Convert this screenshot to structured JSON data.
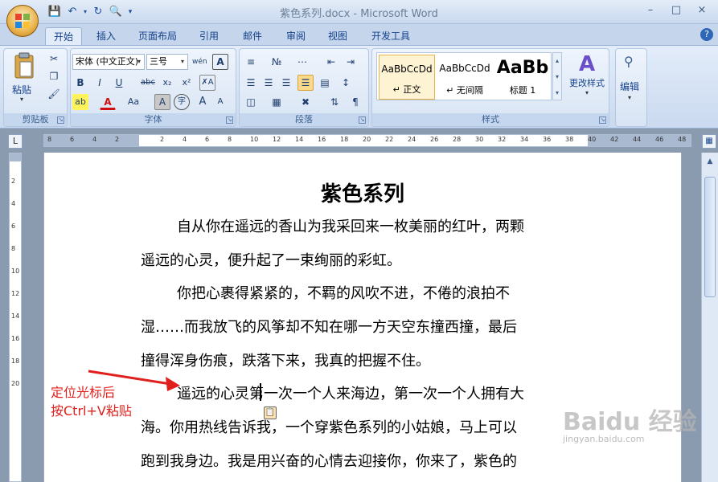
{
  "window": {
    "title": "紫色系列.docx - Microsoft Word",
    "controls": [
      "–",
      "□",
      "×"
    ],
    "help_icon": "?"
  },
  "quick_access": [
    "save-icon",
    "undo-icon",
    "redo-icon",
    "print-preview-icon",
    "customize-icon"
  ],
  "tabs": [
    {
      "label": "开始",
      "active": true
    },
    {
      "label": "插入"
    },
    {
      "label": "页面布局"
    },
    {
      "label": "引用"
    },
    {
      "label": "邮件"
    },
    {
      "label": "审阅"
    },
    {
      "label": "视图"
    },
    {
      "label": "开发工具"
    }
  ],
  "ribbon": {
    "clipboard": {
      "label": "剪贴板",
      "paste": "粘贴"
    },
    "font": {
      "label": "字体",
      "font_name": "宋体 (中文正文)",
      "font_size": "三号",
      "buttons": [
        "B",
        "I",
        "U",
        "abc",
        "x₂",
        "x²",
        "Aa",
        "A",
        "A",
        "A"
      ]
    },
    "paragraph": {
      "label": "段落"
    },
    "styles": {
      "label": "样式",
      "items": [
        {
          "preview": "AaBbCcDd",
          "name": "↵ 正文"
        },
        {
          "preview": "AaBbCcDd",
          "name": "↵ 无间隔"
        },
        {
          "preview": "AaBb",
          "name": "标题 1"
        }
      ],
      "change_styles": "更改样式"
    },
    "editing": {
      "label": "编辑"
    }
  },
  "ruler": {
    "h_numbers": [
      "8",
      "6",
      "4",
      "2",
      "",
      "2",
      "4",
      "6",
      "8",
      "10",
      "12",
      "14",
      "16",
      "18",
      "20",
      "22",
      "24",
      "26",
      "28",
      "30",
      "32",
      "34",
      "36",
      "38",
      "40",
      "42",
      "44",
      "46",
      "48"
    ],
    "v_numbers": [
      "2",
      "4",
      "6",
      "8",
      "10",
      "12",
      "14",
      "16",
      "18",
      "20"
    ]
  },
  "document": {
    "title": "紫色系列",
    "lines": [
      "自从你在遥远的香山为我采回来一枚美丽的红叶，两颗",
      "遥远的心灵，便升起了一束绚丽的彩虹。",
      "你把心裹得紧紧的，不羁的风吹不进，不倦的浪拍不",
      "湿……而我放飞的风筝却不知在哪一方天空东撞西撞，最后",
      "撞得浑身伤痕，跌落下来，我真的把握不住。",
      "遥远的心灵第一次一个人来海边，第一次一个人拥有大",
      "海。你用热线告诉我，一个穿紫色系列的小姑娘，马上可以",
      "跑到我身边。我是用兴奋的心情去迎接你，你来了，紫色的"
    ]
  },
  "annotation": {
    "line1": "定位光标后",
    "line2": "按Ctrl+V粘贴",
    "color": "#e0201c"
  },
  "watermark": {
    "text": "Baidu 经验",
    "sub": "jingyan.baidu.com"
  }
}
